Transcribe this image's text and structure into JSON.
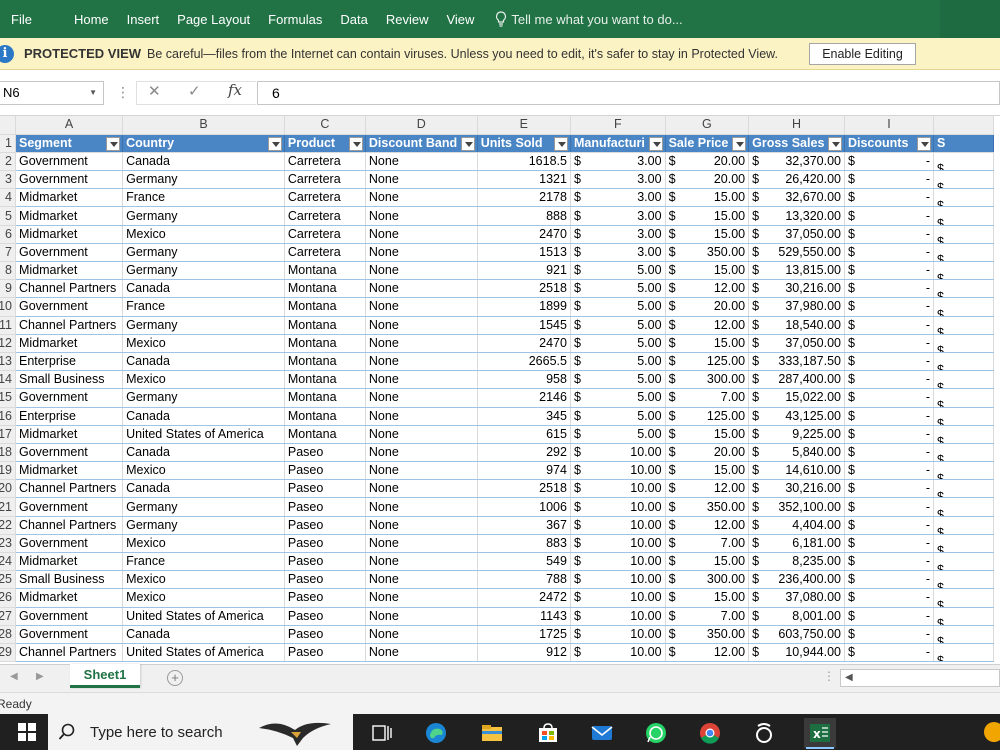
{
  "ribbon": {
    "tabs": [
      "File",
      "Home",
      "Insert",
      "Page Layout",
      "Formulas",
      "Data",
      "Review",
      "View"
    ],
    "tell_me": "Tell me what you want to do..."
  },
  "protected_view": {
    "title": "PROTECTED VIEW",
    "message": "Be careful—files from the Internet can contain viruses. Unless you need to edit, it's safer to stay in Protected View.",
    "button": "Enable Editing"
  },
  "formula_bar": {
    "name_box": "N6",
    "fx_label": "fx",
    "value": "6"
  },
  "grid": {
    "columns": [
      "A",
      "B",
      "C",
      "D",
      "E",
      "F",
      "G",
      "H",
      "I"
    ],
    "headers": [
      "Segment",
      "Country",
      "Product",
      "Discount Band",
      "Units Sold",
      "Manufacturi",
      "Sale Price",
      "Gross Sales",
      "Discounts",
      "S"
    ],
    "rows": [
      {
        "n": "2",
        "cells": [
          "Government",
          "Canada",
          "Carretera",
          "None",
          "1618.5",
          "3.00",
          "20.00",
          "32,370.00",
          "-"
        ]
      },
      {
        "n": "3",
        "cells": [
          "Government",
          "Germany",
          "Carretera",
          "None",
          "1321",
          "3.00",
          "20.00",
          "26,420.00",
          "-"
        ]
      },
      {
        "n": "4",
        "cells": [
          "Midmarket",
          "France",
          "Carretera",
          "None",
          "2178",
          "3.00",
          "15.00",
          "32,670.00",
          "-"
        ]
      },
      {
        "n": "5",
        "cells": [
          "Midmarket",
          "Germany",
          "Carretera",
          "None",
          "888",
          "3.00",
          "15.00",
          "13,320.00",
          "-"
        ]
      },
      {
        "n": "6",
        "cells": [
          "Midmarket",
          "Mexico",
          "Carretera",
          "None",
          "2470",
          "3.00",
          "15.00",
          "37,050.00",
          "-"
        ]
      },
      {
        "n": "7",
        "cells": [
          "Government",
          "Germany",
          "Carretera",
          "None",
          "1513",
          "3.00",
          "350.00",
          "529,550.00",
          "-"
        ]
      },
      {
        "n": "8",
        "cells": [
          "Midmarket",
          "Germany",
          "Montana",
          "None",
          "921",
          "5.00",
          "15.00",
          "13,815.00",
          "-"
        ]
      },
      {
        "n": "9",
        "cells": [
          "Channel Partners",
          "Canada",
          "Montana",
          "None",
          "2518",
          "5.00",
          "12.00",
          "30,216.00",
          "-"
        ]
      },
      {
        "n": "10",
        "cells": [
          "Government",
          "France",
          "Montana",
          "None",
          "1899",
          "5.00",
          "20.00",
          "37,980.00",
          "-"
        ]
      },
      {
        "n": "11",
        "cells": [
          "Channel Partners",
          "Germany",
          "Montana",
          "None",
          "1545",
          "5.00",
          "12.00",
          "18,540.00",
          "-"
        ]
      },
      {
        "n": "12",
        "cells": [
          "Midmarket",
          "Mexico",
          "Montana",
          "None",
          "2470",
          "5.00",
          "15.00",
          "37,050.00",
          "-"
        ]
      },
      {
        "n": "13",
        "cells": [
          "Enterprise",
          "Canada",
          "Montana",
          "None",
          "2665.5",
          "5.00",
          "125.00",
          "333,187.50",
          "-"
        ]
      },
      {
        "n": "14",
        "cells": [
          "Small Business",
          "Mexico",
          "Montana",
          "None",
          "958",
          "5.00",
          "300.00",
          "287,400.00",
          "-"
        ]
      },
      {
        "n": "15",
        "cells": [
          "Government",
          "Germany",
          "Montana",
          "None",
          "2146",
          "5.00",
          "7.00",
          "15,022.00",
          "-"
        ]
      },
      {
        "n": "16",
        "cells": [
          "Enterprise",
          "Canada",
          "Montana",
          "None",
          "345",
          "5.00",
          "125.00",
          "43,125.00",
          "-"
        ]
      },
      {
        "n": "17",
        "cells": [
          "Midmarket",
          "United States of America",
          "Montana",
          "None",
          "615",
          "5.00",
          "15.00",
          "9,225.00",
          "-"
        ]
      },
      {
        "n": "18",
        "cells": [
          "Government",
          "Canada",
          "Paseo",
          "None",
          "292",
          "10.00",
          "20.00",
          "5,840.00",
          "-"
        ]
      },
      {
        "n": "19",
        "cells": [
          "Midmarket",
          "Mexico",
          "Paseo",
          "None",
          "974",
          "10.00",
          "15.00",
          "14,610.00",
          "-"
        ]
      },
      {
        "n": "20",
        "cells": [
          "Channel Partners",
          "Canada",
          "Paseo",
          "None",
          "2518",
          "10.00",
          "12.00",
          "30,216.00",
          "-"
        ]
      },
      {
        "n": "21",
        "cells": [
          "Government",
          "Germany",
          "Paseo",
          "None",
          "1006",
          "10.00",
          "350.00",
          "352,100.00",
          "-"
        ]
      },
      {
        "n": "22",
        "cells": [
          "Channel Partners",
          "Germany",
          "Paseo",
          "None",
          "367",
          "10.00",
          "12.00",
          "4,404.00",
          "-"
        ]
      },
      {
        "n": "23",
        "cells": [
          "Government",
          "Mexico",
          "Paseo",
          "None",
          "883",
          "10.00",
          "7.00",
          "6,181.00",
          "-"
        ]
      },
      {
        "n": "24",
        "cells": [
          "Midmarket",
          "France",
          "Paseo",
          "None",
          "549",
          "10.00",
          "15.00",
          "8,235.00",
          "-"
        ]
      },
      {
        "n": "25",
        "cells": [
          "Small Business",
          "Mexico",
          "Paseo",
          "None",
          "788",
          "10.00",
          "300.00",
          "236,400.00",
          "-"
        ]
      },
      {
        "n": "26",
        "cells": [
          "Midmarket",
          "Mexico",
          "Paseo",
          "None",
          "2472",
          "10.00",
          "15.00",
          "37,080.00",
          "-"
        ]
      },
      {
        "n": "27",
        "cells": [
          "Government",
          "United States of America",
          "Paseo",
          "None",
          "1143",
          "10.00",
          "7.00",
          "8,001.00",
          "-"
        ]
      },
      {
        "n": "28",
        "cells": [
          "Government",
          "Canada",
          "Paseo",
          "None",
          "1725",
          "10.00",
          "350.00",
          "603,750.00",
          "-"
        ]
      },
      {
        "n": "29",
        "cells": [
          "Channel Partners",
          "United States of America",
          "Paseo",
          "None",
          "912",
          "10.00",
          "12.00",
          "10,944.00",
          "-"
        ]
      }
    ],
    "currency_symbol": "$",
    "selected_cell": "N6"
  },
  "sheet_tabs": {
    "active": "Sheet1"
  },
  "status_bar": {
    "text": "Ready"
  },
  "taskbar": {
    "search_placeholder": "Type here to search",
    "icons": [
      "windows-icon",
      "search-icon",
      "task-view-icon",
      "edge-icon",
      "file-explorer-icon",
      "store-icon",
      "mail-icon",
      "whatsapp-icon",
      "chrome-icon",
      "app-icon",
      "excel-icon"
    ]
  },
  "colors": {
    "excel_green": "#217346",
    "table_header_blue": "#4a86c6",
    "protected_yellow": "#fcf3c5"
  }
}
